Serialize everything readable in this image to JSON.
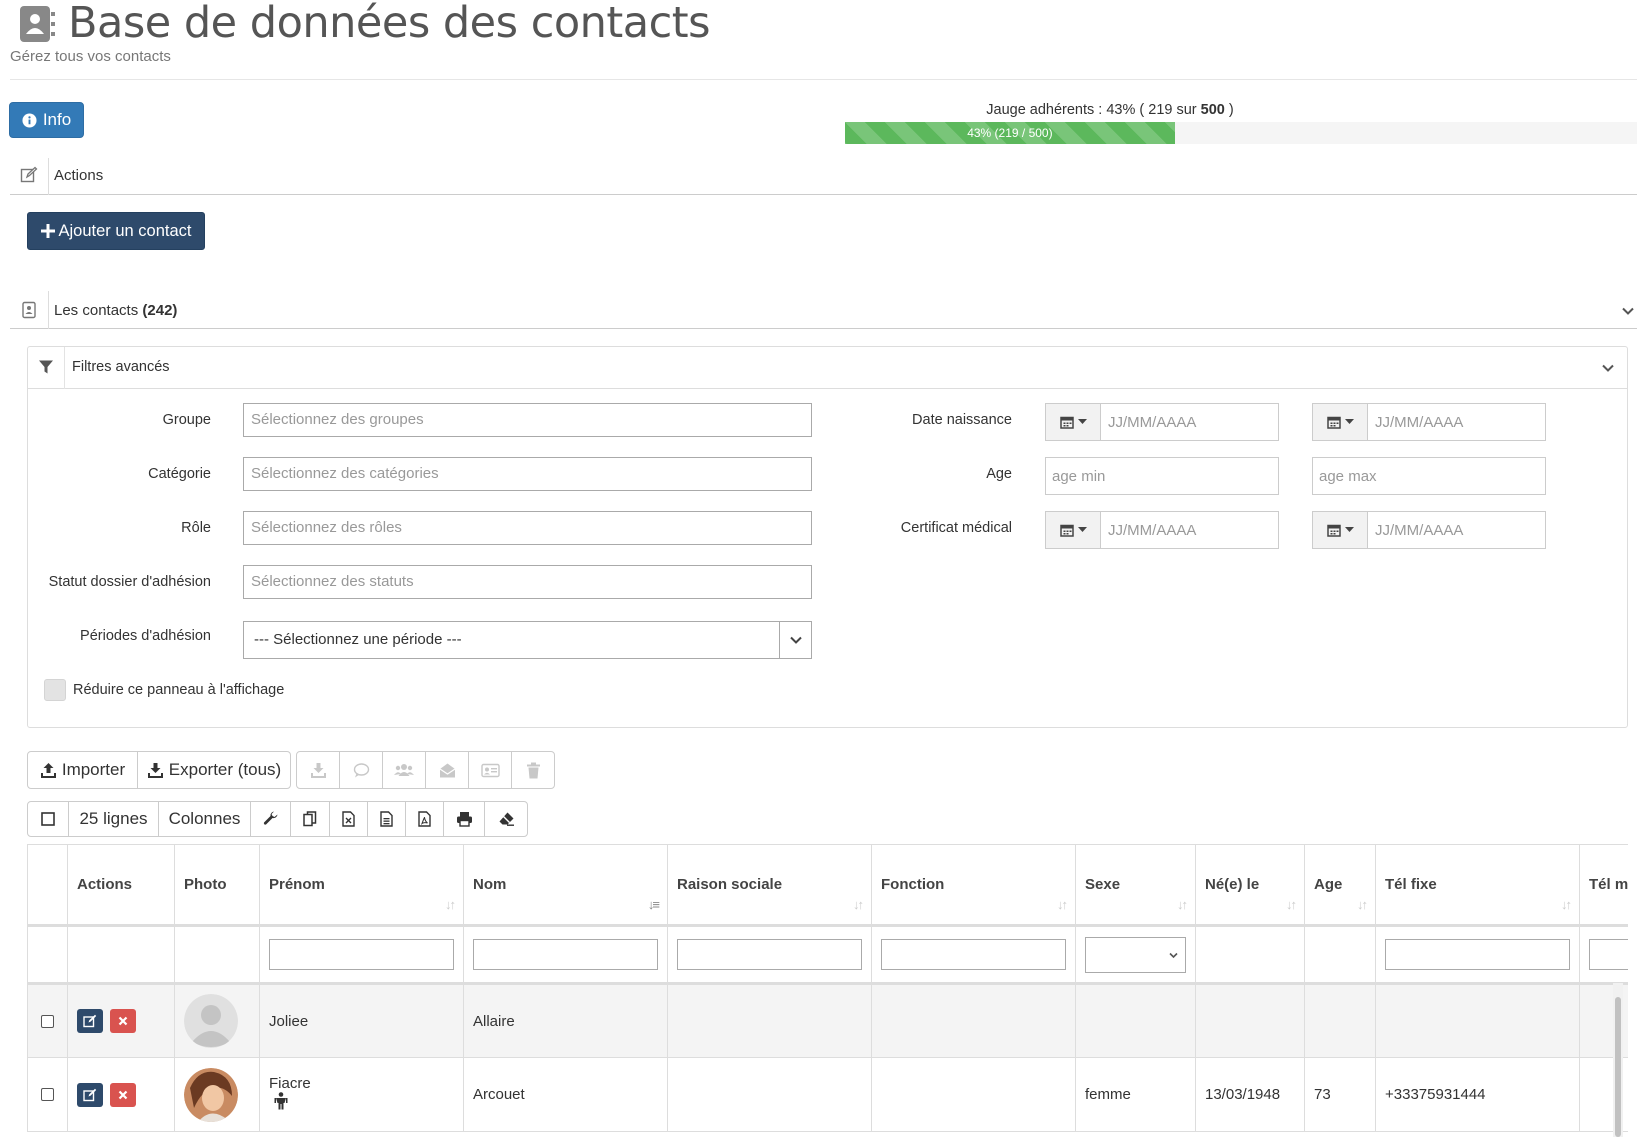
{
  "header": {
    "title": "Base de données des contacts",
    "subtitle": "Gérez tous vos contacts",
    "icon": "contact-book-icon"
  },
  "info_button": {
    "label": "Info",
    "icon": "info-circle-icon"
  },
  "gauge": {
    "label_prefix": "Jauge adhérents : 43% ( 219 sur ",
    "label_max": "500",
    "label_suffix": " )",
    "bar_text": "43% (219 / 500)",
    "percent": 43,
    "current": 219,
    "max": 500,
    "color": "#5cb85c"
  },
  "actions_section": {
    "label": "Actions",
    "icon": "edit-icon"
  },
  "add_button": {
    "label": "Ajouter un contact",
    "icon": "plus-icon",
    "color": "#2e4a6b"
  },
  "contacts_section": {
    "label": "Les contacts ",
    "count": "(242)",
    "icon": "address-card-icon"
  },
  "filters": {
    "title": "Filtres avancés",
    "icon": "filter-icon",
    "groupe": {
      "label": "Groupe",
      "placeholder": "Sélectionnez des groupes"
    },
    "categorie": {
      "label": "Catégorie",
      "placeholder": "Sélectionnez des catégories"
    },
    "role": {
      "label": "Rôle",
      "placeholder": "Sélectionnez des rôles"
    },
    "statut": {
      "label": "Statut dossier d'adhésion",
      "placeholder": "Sélectionnez des statuts"
    },
    "periodes": {
      "label": "Périodes d'adhésion",
      "selected": "--- Sélectionnez une période ---"
    },
    "date_naissance": {
      "label": "Date naissance",
      "from_placeholder": "JJ/MM/AAAA",
      "to_placeholder": "JJ/MM/AAAA"
    },
    "age": {
      "label": "Age",
      "min_placeholder": "age min",
      "max_placeholder": "age max"
    },
    "certificat": {
      "label": "Certificat médical",
      "from_placeholder": "JJ/MM/AAAA",
      "to_placeholder": "JJ/MM/AAAA"
    },
    "reduce_label": "Réduire ce panneau à l'affichage"
  },
  "toolbar1": {
    "import_label": "Importer",
    "export_label": "Exporter (tous)",
    "disabled_icons": [
      "download-icon",
      "comment-icon",
      "users-icon",
      "envelope-open-icon",
      "id-card-icon",
      "trash-icon"
    ]
  },
  "toolbar2": {
    "lines_label": "25 lignes",
    "columns_label": "Colonnes",
    "icons": [
      "checkbox-icon",
      "wrench-icon",
      "copy-icon",
      "excel-icon",
      "csv-icon",
      "pdf-icon",
      "print-icon",
      "eraser-icon"
    ]
  },
  "table": {
    "columns": [
      "Actions",
      "Photo",
      "Prénom",
      "Nom",
      "Raison sociale",
      "Fonction",
      "Sexe",
      "Né(e) le",
      "Age",
      "Tél fixe",
      "Tél mo"
    ],
    "rows": [
      {
        "prenom": "Joliee",
        "nom": "Allaire",
        "raison": "",
        "fonction": "",
        "sexe": "",
        "naissance": "",
        "age": "",
        "tel": ""
      },
      {
        "prenom": "Fiacre",
        "nom": "Arcouet",
        "raison": "",
        "fonction": "",
        "sexe": "femme",
        "naissance": "13/03/1948",
        "age": "73",
        "tel": "+33375931444"
      }
    ]
  }
}
